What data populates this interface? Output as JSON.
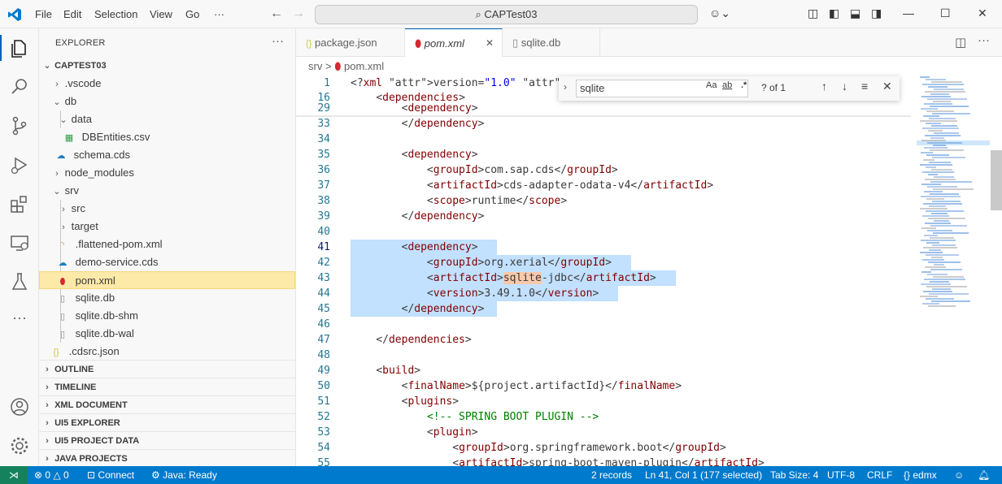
{
  "titlebar": {
    "menu": [
      "File",
      "Edit",
      "Selection",
      "View",
      "Go"
    ],
    "menu_more": "···",
    "search_text": "CAPTest03"
  },
  "explorer": {
    "title": "EXPLORER",
    "more": "···",
    "root": "CAPTEST03",
    "items": [
      {
        "label": ".vscode",
        "kind": "folder",
        "open": false
      },
      {
        "label": "db",
        "kind": "folder",
        "open": true
      },
      {
        "label": "data",
        "kind": "folder",
        "open": true
      },
      {
        "label": "DBEntities.csv",
        "kind": "csv"
      },
      {
        "label": "schema.cds",
        "kind": "cds"
      },
      {
        "label": "node_modules",
        "kind": "folder",
        "open": false
      },
      {
        "label": "srv",
        "kind": "folder",
        "open": true
      },
      {
        "label": "src",
        "kind": "folder",
        "open": false
      },
      {
        "label": "target",
        "kind": "folder",
        "open": false
      },
      {
        "label": ".flattened-pom.xml",
        "kind": "rss"
      },
      {
        "label": "demo-service.cds",
        "kind": "cds"
      },
      {
        "label": "pom.xml",
        "kind": "pom"
      },
      {
        "label": "sqlite.db",
        "kind": "file"
      },
      {
        "label": "sqlite.db-shm",
        "kind": "file"
      },
      {
        "label": "sqlite.db-wal",
        "kind": "file"
      },
      {
        "label": ".cdsrc.json",
        "kind": "json"
      }
    ],
    "sections": [
      "OUTLINE",
      "TIMELINE",
      "XML DOCUMENT",
      "UI5 EXPLORER",
      "UI5 PROJECT DATA",
      "JAVA PROJECTS"
    ]
  },
  "tabs": [
    {
      "label": "package.json",
      "icon": "{}"
    },
    {
      "label": "pom.xml",
      "icon": "pom"
    },
    {
      "label": "sqlite.db",
      "icon": "file"
    }
  ],
  "breadcrumb": {
    "folder": "srv",
    "sep": ">",
    "file": "pom.xml"
  },
  "find": {
    "query": "sqlite",
    "opt_case": "Aa",
    "opt_word": "ab",
    "opt_regex": ".*",
    "count": "? of 1"
  },
  "editor": {
    "lines": [
      {
        "n": "1",
        "t": "<?xml version=\"1.0\" encoding=\"UTF"
      },
      {
        "n": "16",
        "t": "    <dependencies>"
      },
      {
        "n": "29",
        "t": "        <dependency>"
      },
      {
        "n": "33",
        "t": "        </dependency>"
      },
      {
        "n": "34",
        "t": ""
      },
      {
        "n": "35",
        "t": "        <dependency>"
      },
      {
        "n": "36",
        "t": "            <groupId>com.sap.cds</groupId>"
      },
      {
        "n": "37",
        "t": "            <artifactId>cds-adapter-odata-v4</artifactId>"
      },
      {
        "n": "38",
        "t": "            <scope>runtime</scope>"
      },
      {
        "n": "39",
        "t": "        </dependency>"
      },
      {
        "n": "40",
        "t": ""
      },
      {
        "n": "41",
        "t": "        <dependency>"
      },
      {
        "n": "42",
        "t": "            <groupId>org.xerial</groupId>"
      },
      {
        "n": "43",
        "t": "            <artifactId>sqlite-jdbc</artifactId>"
      },
      {
        "n": "44",
        "t": "            <version>3.49.1.0</version>"
      },
      {
        "n": "45",
        "t": "        </dependency>"
      },
      {
        "n": "46",
        "t": ""
      },
      {
        "n": "47",
        "t": "    </dependencies>"
      },
      {
        "n": "48",
        "t": ""
      },
      {
        "n": "49",
        "t": "    <build>"
      },
      {
        "n": "50",
        "t": "        <finalName>${project.artifactId}</finalName>"
      },
      {
        "n": "51",
        "t": "        <plugins>"
      },
      {
        "n": "52",
        "t": "            <!-- SPRING BOOT PLUGIN -->"
      },
      {
        "n": "53",
        "t": "            <plugin>"
      },
      {
        "n": "54",
        "t": "                <groupId>org.springframework.boot</groupId>"
      },
      {
        "n": "55",
        "t": "                <artifactId>spring-boot-maven-plugin</artifactId>"
      }
    ],
    "line1_tail": "e."
  },
  "statusbar": {
    "errors": "0",
    "warnings": "0",
    "connect": "Connect",
    "java": "Java: Ready",
    "records": "2 records",
    "position": "Ln 41, Col 1 (177 selected)",
    "tabsize": "Tab Size: 4",
    "encoding": "UTF-8",
    "eol": "CRLF",
    "language": "edmx"
  },
  "colors": {
    "accent": "#007acc",
    "selection": "#add6ff",
    "selected_item": "#fde9a8"
  }
}
